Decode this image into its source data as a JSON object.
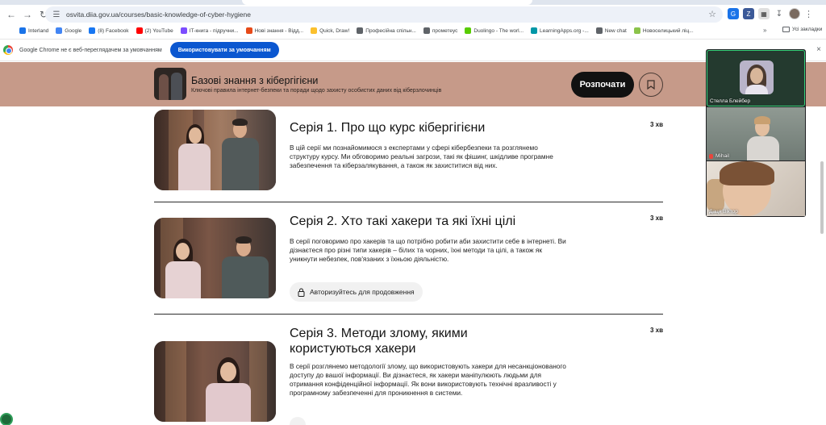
{
  "browser": {
    "url": "osvita.diia.gov.ua/courses/basic-knowledge-of-cyber-hygiene",
    "bookmarks": [
      {
        "label": "Interland",
        "color": "#1a73e8"
      },
      {
        "label": "Google",
        "color": "#4285f4"
      },
      {
        "label": "(8) Facebook",
        "color": "#1877f2"
      },
      {
        "label": "(2) YouTube",
        "color": "#ff0000"
      },
      {
        "label": "IT-книга - підручни...",
        "color": "#7c4dff"
      },
      {
        "label": "Нові знання - Відд...",
        "color": "#e64a19"
      },
      {
        "label": "Quick, Draw!",
        "color": "#fbc02d"
      },
      {
        "label": "Професійна спільн...",
        "color": "#5f6368"
      },
      {
        "label": "прометеус",
        "color": "#5f6368"
      },
      {
        "label": "Duolingo - The worl...",
        "color": "#58cc02"
      },
      {
        "label": "LearningApps.org -...",
        "color": "#0097a7"
      },
      {
        "label": "New chat",
        "color": "#5f6368"
      },
      {
        "label": "Новоселицький ліц...",
        "color": "#8bc34a"
      }
    ],
    "bookmarks_more": "»",
    "all_bookmarks": "Усі закладки",
    "infobar": {
      "message": "Google Chrome не є веб-переглядачем за умовчанням",
      "button": "Використовувати за умовчанням",
      "close": "×"
    }
  },
  "course": {
    "title": "Базові знання з кібергігієни",
    "subtitle": "Ключові правила інтернет-безпеки та поради щодо захисту особистих даних від кіберзлочинців",
    "start_label": "Розпочати"
  },
  "episodes": [
    {
      "title": "Серія 1. Про що курс кібергігієни",
      "duration": "3 хв",
      "description": "В цій серії ми познайомимося з експертами у сфері кібербезпеки та розглянемо структуру курсу. Ми обговоримо реальні загрози, такі як фішинг, шкідливе програмне забезпечення та кіберзалякування, а також як захиститися від них."
    },
    {
      "title": "Серія 2. Хто такі хакери та які їхні цілі",
      "duration": "3 хв",
      "description": "В серії поговоримо про хакерів та що потрібно робити аби захистити себе в інтернеті. Ви дізнаєтеся про різні типи хакерів – білих та чорних, їхні методи та цілі, а також як уникнути небезпек, пов'язаних з їхньою діяльністю.",
      "auth_label": "Авторизуйтесь для продовження"
    },
    {
      "title": "Серія 3. Методи злому, якими користуються хакери",
      "duration": "3 хв",
      "description": "В серії розглянемо методології злому, що використовують хакери для несанкціонованого доступу до вашої інформації. Ви дізнаєтеся, як хакери маніпулюють людьми для отримання конфіденційної інформації. Як вони використовують технічні вразливості у програмному забезпеченні для проникнення в системи."
    }
  ],
  "call": {
    "participants": [
      {
        "name": "Стелла Блейбер"
      },
      {
        "name": "Mihail"
      },
      {
        "name": "Даця Віктор"
      }
    ]
  }
}
